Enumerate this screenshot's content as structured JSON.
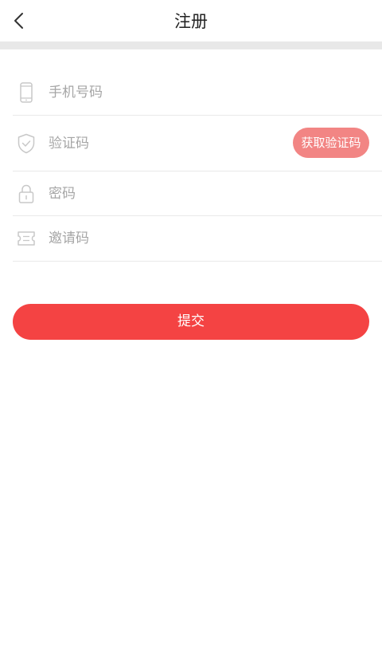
{
  "header": {
    "title": "注册",
    "back_icon": "chevron-left-icon"
  },
  "form": {
    "phone": {
      "placeholder": "手机号码",
      "value": "",
      "icon": "phone-icon"
    },
    "code": {
      "placeholder": "验证码",
      "value": "",
      "icon": "shield-check-icon",
      "button_label": "获取验证码"
    },
    "password": {
      "placeholder": "密码",
      "value": "",
      "icon": "lock-icon"
    },
    "invite": {
      "placeholder": "邀请码",
      "value": "",
      "icon": "ticket-icon"
    }
  },
  "submit": {
    "label": "提交"
  },
  "colors": {
    "accent": "#f44343",
    "code_button": "#f28584",
    "divider": "#e9e9e9",
    "band": "#e8e8e8",
    "placeholder": "#a6a6a6",
    "icon": "#c8c8c8"
  }
}
